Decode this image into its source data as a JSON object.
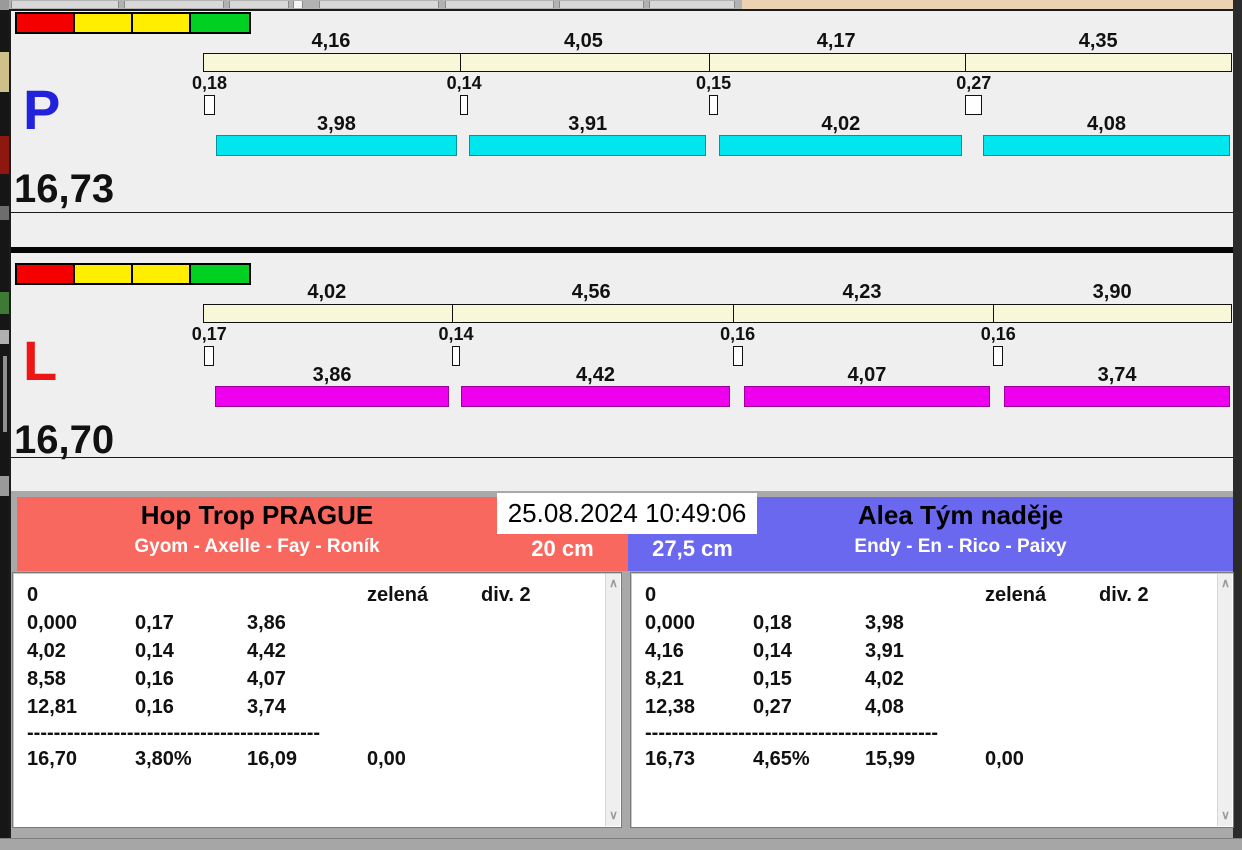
{
  "traffic_lights": [
    "#f40000",
    "#ffee00",
    "#ffee00",
    "#00d022"
  ],
  "panels": [
    {
      "letter": "P",
      "letter_color": "#2222dd",
      "total": "16,73",
      "bar_color": "#00e6ef",
      "segments": [
        {
          "split": "4,16",
          "gap": "0,18",
          "work": "3,98"
        },
        {
          "split": "4,05",
          "gap": "0,14",
          "work": "3,91"
        },
        {
          "split": "4,17",
          "gap": "0,15",
          "work": "4,02"
        },
        {
          "split": "4,35",
          "gap": "0,27",
          "work": "4,08"
        }
      ]
    },
    {
      "letter": "L",
      "letter_color": "#ee1515",
      "total": "16,70",
      "bar_color": "#ee00ee",
      "segments": [
        {
          "split": "4,02",
          "gap": "0,17",
          "work": "3,86"
        },
        {
          "split": "4,56",
          "gap": "0,14",
          "work": "4,42"
        },
        {
          "split": "4,23",
          "gap": "0,16",
          "work": "4,07"
        },
        {
          "split": "3,90",
          "gap": "0,16",
          "work": "3,74"
        }
      ]
    }
  ],
  "footer": {
    "timestamp": "25.08.2024 10:49:06",
    "left_team": {
      "name": "Hop Trop PRAGUE",
      "members": "Gyom - Axelle - Fay - Roník",
      "distance": "20 cm",
      "color": "#f9685f"
    },
    "right_team": {
      "name": "Alea Tým naděje",
      "members": "Endy - En - Rico - Paixy",
      "distance": "27,5 cm",
      "color": "#6a68ee"
    },
    "left_table": {
      "first_row": {
        "num": "0",
        "flag": "zelená",
        "division": "div. 2"
      },
      "rows": [
        [
          "0,000",
          "0,17",
          "3,86"
        ],
        [
          "4,02",
          "0,14",
          "4,42"
        ],
        [
          "8,58",
          "0,16",
          "4,07"
        ],
        [
          "12,81",
          "0,16",
          "3,74"
        ]
      ],
      "separator": "--------------------------------------------",
      "summary": [
        "16,70",
        "3,80%",
        "16,09",
        "0,00"
      ]
    },
    "right_table": {
      "first_row": {
        "num": "0",
        "flag": "zelená",
        "division": "div. 2"
      },
      "rows": [
        [
          "0,000",
          "0,18",
          "3,98"
        ],
        [
          "4,16",
          "0,14",
          "3,91"
        ],
        [
          "8,21",
          "0,15",
          "4,02"
        ],
        [
          "12,38",
          "0,27",
          "4,08"
        ]
      ],
      "separator": "--------------------------------------------",
      "summary": [
        "16,73",
        "4,65%",
        "15,99",
        "0,00"
      ]
    }
  },
  "scroll_icons": {
    "up": "∧",
    "down": "∨"
  }
}
